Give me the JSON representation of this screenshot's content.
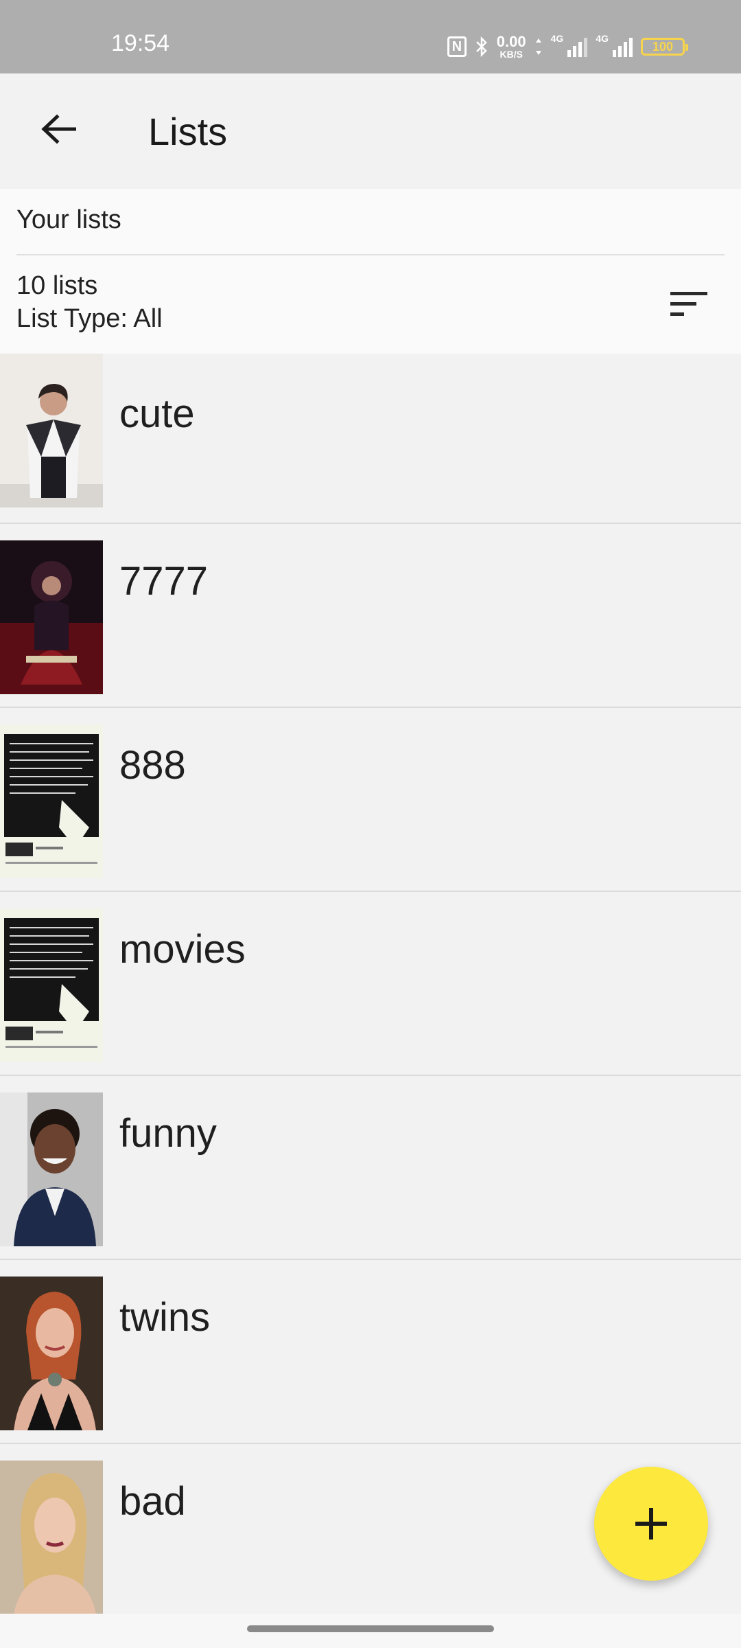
{
  "status_bar": {
    "time": "19:54",
    "speed_value": "0.00",
    "speed_unit": "KB/S",
    "network_1": "4G",
    "network_2": "4G",
    "battery": "100"
  },
  "app_bar": {
    "title": "Lists",
    "back_icon": "arrow-left-icon"
  },
  "header": {
    "section_title": "Your lists",
    "count": "10 lists",
    "list_type": "List Type: All",
    "sort_icon": "sort-icon"
  },
  "lists": [
    {
      "name": "cute",
      "thumb": "portrait-woman-dark-hair"
    },
    {
      "name": "7777",
      "thumb": "movie-poster-doctor-strange"
    },
    {
      "name": "888",
      "thumb": "text-poster-black-white"
    },
    {
      "name": "movies",
      "thumb": "text-poster-black-white"
    },
    {
      "name": "funny",
      "thumb": "portrait-man-smiling"
    },
    {
      "name": "twins",
      "thumb": "portrait-woman-red-hair"
    },
    {
      "name": "bad",
      "thumb": "portrait-woman-blonde"
    }
  ],
  "fab": {
    "icon": "plus-icon"
  },
  "colors": {
    "accent": "#fde83e",
    "status_bar": "#aeaeae",
    "background": "#f2f2f2"
  }
}
